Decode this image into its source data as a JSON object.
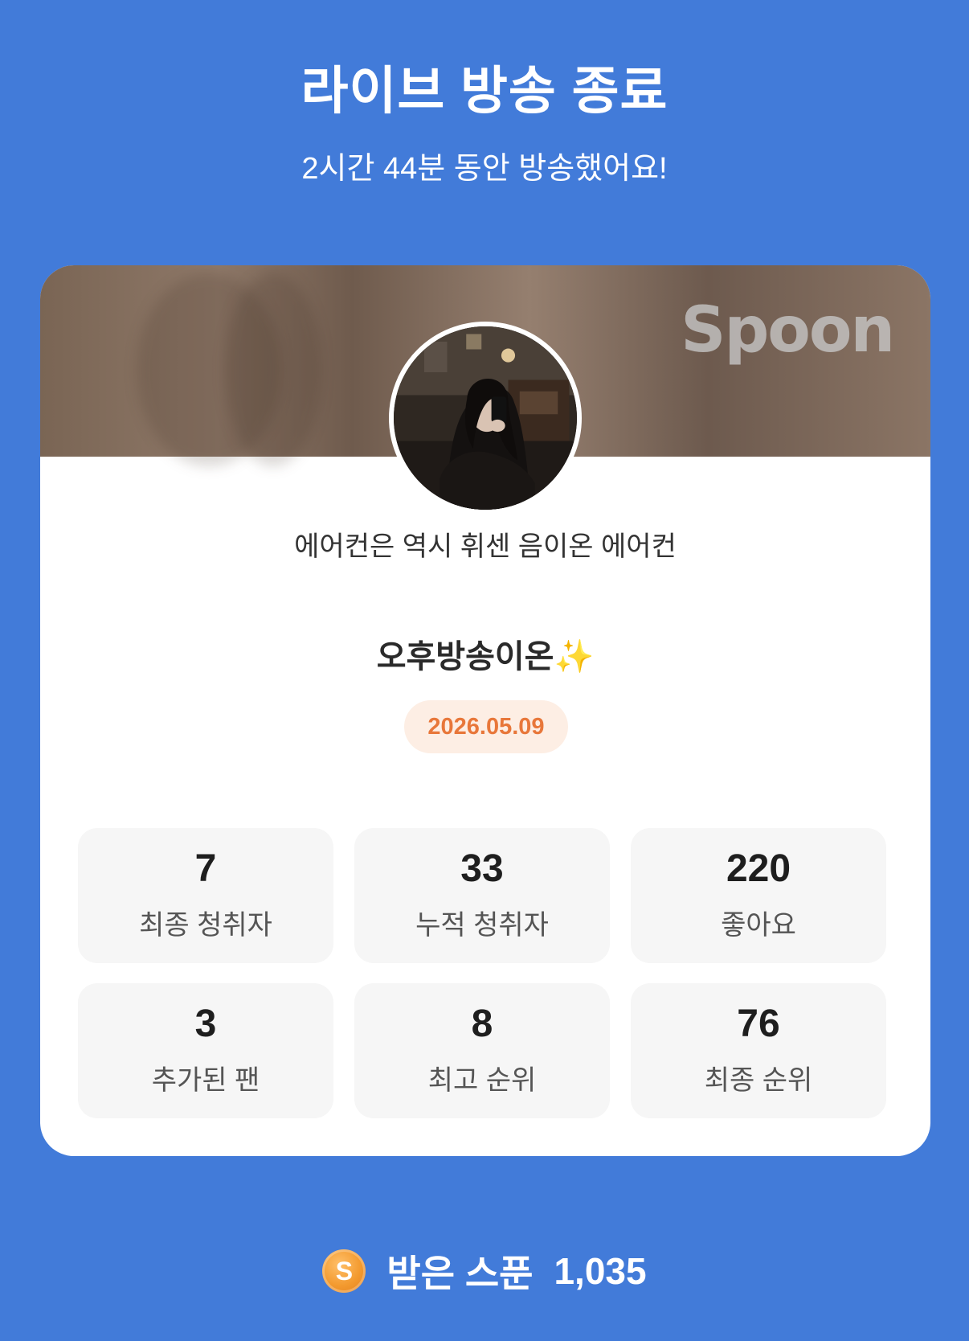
{
  "header": {
    "title": "라이브 방송 종료",
    "subtitle": "2시간 44분 동안 방송했어요!"
  },
  "card": {
    "logo_text": "Spoon",
    "nickname": "에어컨은 역시 휘센 음이온 에어컨",
    "broadcast_title": "오후방송이온✨",
    "date": "2026.05.09",
    "stats": [
      {
        "value": "7",
        "label": "최종 청취자"
      },
      {
        "value": "33",
        "label": "누적 청취자"
      },
      {
        "value": "220",
        "label": "좋아요"
      },
      {
        "value": "3",
        "label": "추가된 팬"
      },
      {
        "value": "8",
        "label": "최고 순위"
      },
      {
        "value": "76",
        "label": "최종 순위"
      }
    ]
  },
  "footer": {
    "coin_symbol": "S",
    "label": "받은 스푼",
    "value": "1,035"
  },
  "colors": {
    "background": "#427bd9",
    "date_text": "#e8773a",
    "date_pill": "#fdeee4",
    "coin": "#f39a2f"
  }
}
